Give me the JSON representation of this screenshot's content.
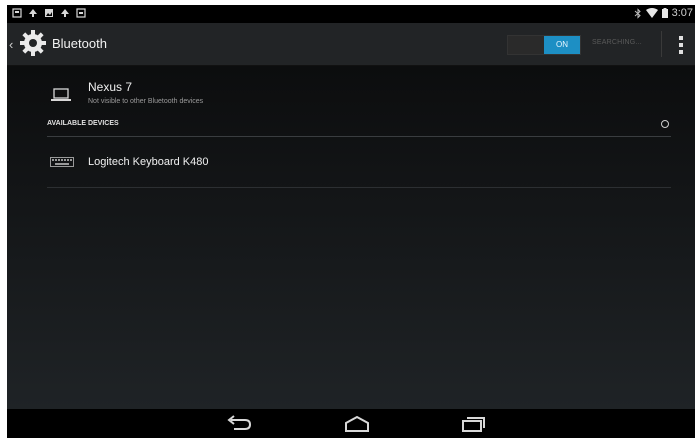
{
  "status_bar": {
    "left_icons": [
      "notification-icon",
      "upload-icon",
      "gallery-icon",
      "upload-icon",
      "notification-icon"
    ],
    "time": "3:07"
  },
  "action_bar": {
    "title": "Bluetooth",
    "toggle_label": "ON",
    "searching_label": "SEARCHING..."
  },
  "paired_device": {
    "name": "Nexus 7",
    "subtitle": "Not visible to other Bluetooth devices",
    "icon": "laptop-icon"
  },
  "available": {
    "header": "AVAILABLE DEVICES",
    "devices": [
      {
        "name": "Logitech Keyboard K480",
        "icon": "keyboard-icon"
      }
    ]
  },
  "navigation": {
    "buttons": [
      "back-icon",
      "home-icon",
      "recents-icon"
    ]
  },
  "colors": {
    "accent": "#1d8fc4",
    "action_bar": "#222426",
    "background": "#000000"
  }
}
